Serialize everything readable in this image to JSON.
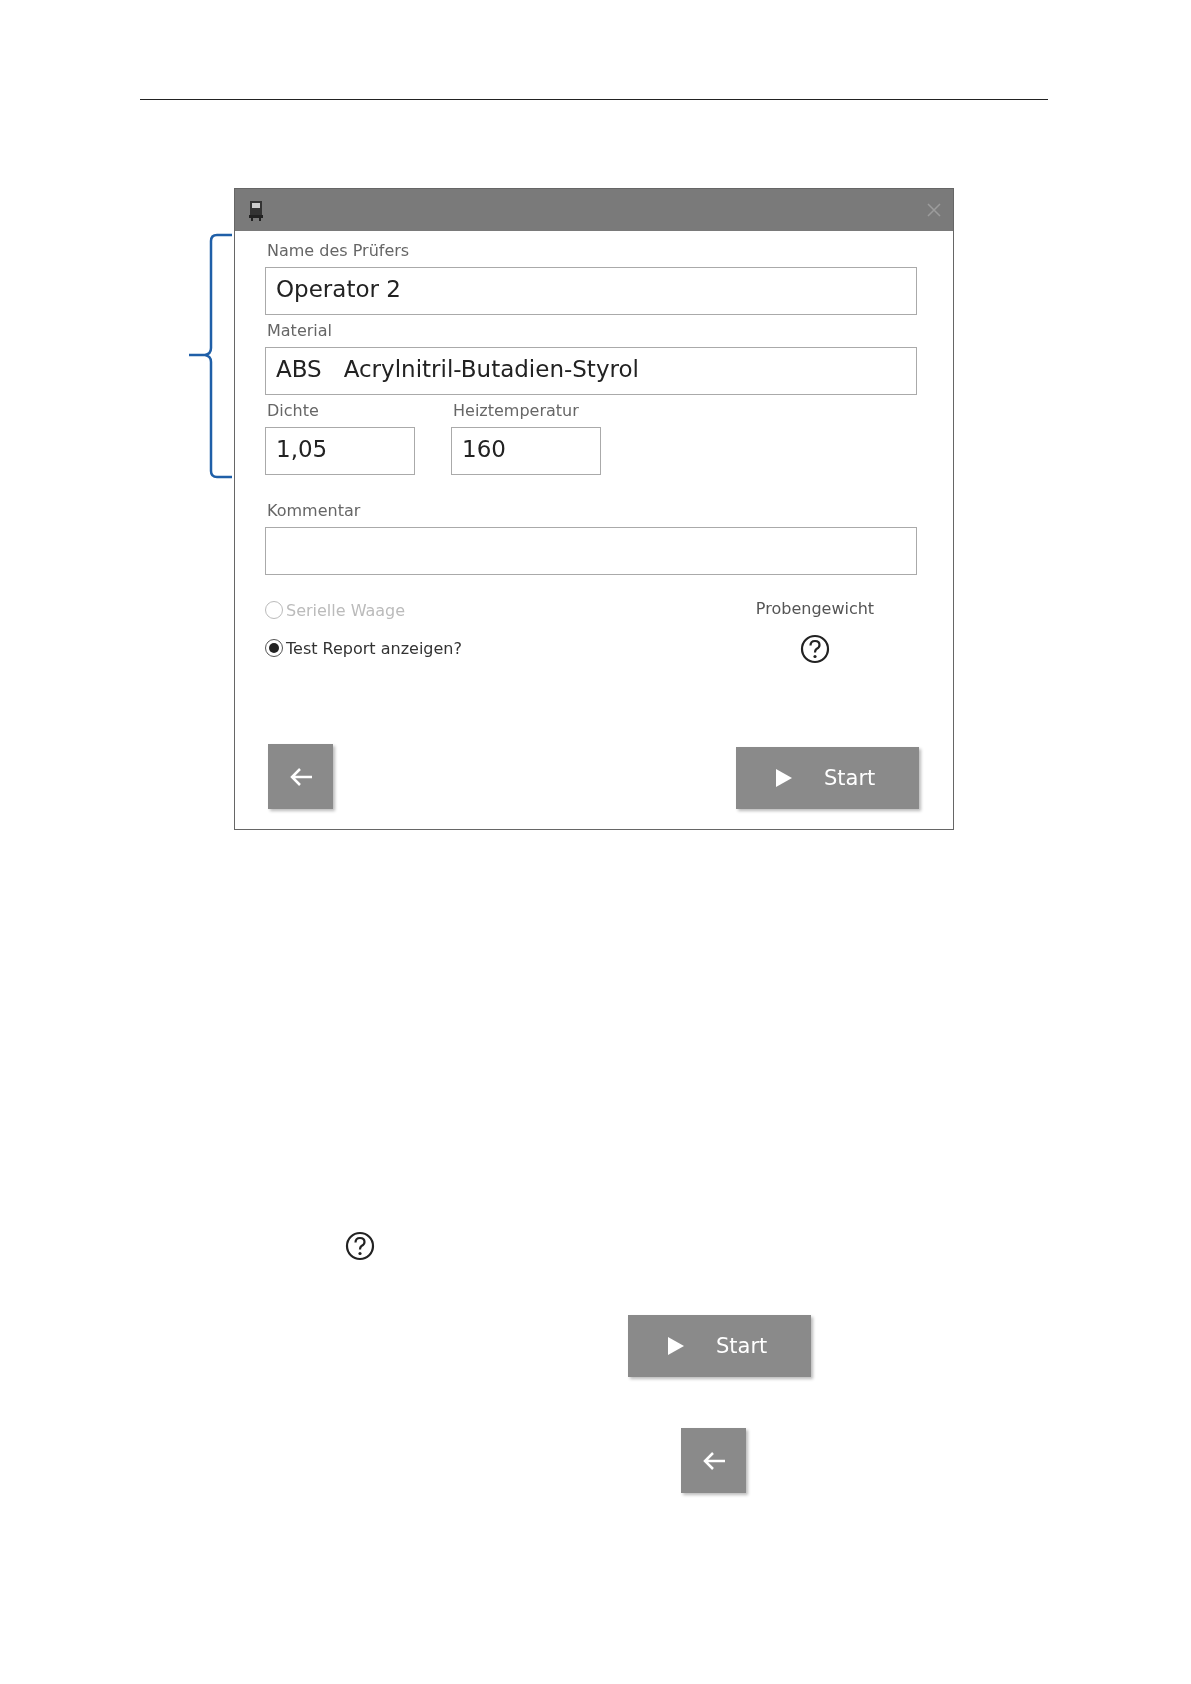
{
  "dialog": {
    "fields": [
      {
        "kind": "wide",
        "label": "Name des Prüfers",
        "value": "Operator 2"
      },
      {
        "kind": "wide",
        "label": "Material",
        "value": "ABS   Acrylnitril-Butadien-Styrol"
      },
      {
        "kind": "short",
        "label": "Dichte",
        "value": "1,05"
      },
      {
        "kind": "short",
        "label": "Heiztemperatur",
        "value": "160"
      },
      {
        "kind": "wide",
        "label": "Kommentar"
      }
    ],
    "options": [
      {
        "label": "Serielle Waage",
        "selected": false,
        "disabled": true
      },
      {
        "label": "Test Report anzeigen?",
        "selected": true,
        "disabled": false
      }
    ],
    "sample_weight_label": "Probengewicht",
    "start_button": "Start"
  },
  "legend": {
    "start_button": "Start"
  }
}
